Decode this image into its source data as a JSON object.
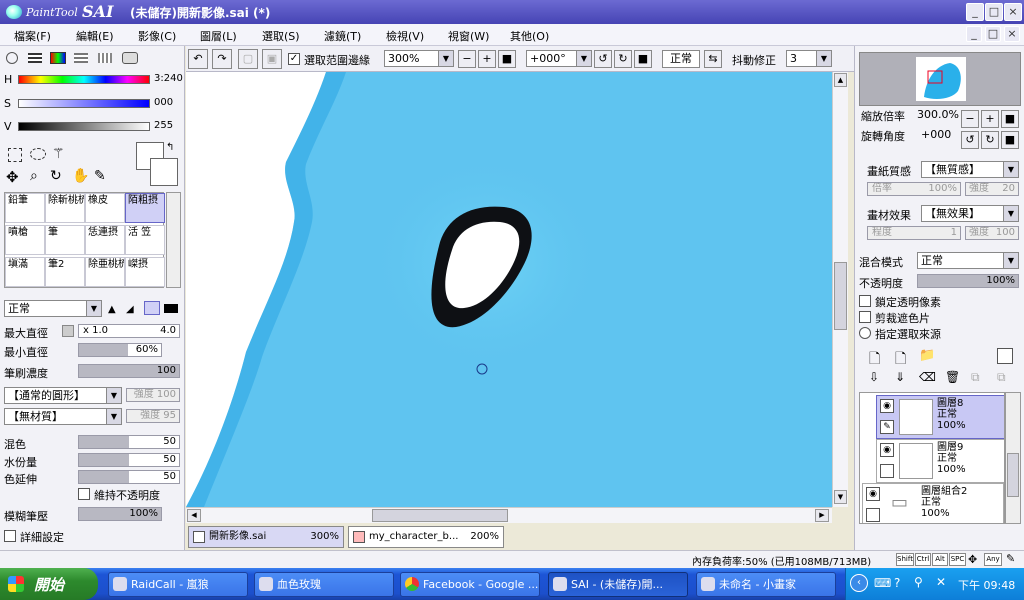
{
  "app": {
    "logo_small": "PaintTool",
    "logo_big": "SAI",
    "title": "(未儲存)開新影像.sai (*)"
  },
  "window_buttons": [
    "_",
    "□",
    "×"
  ],
  "menu": [
    "檔案(F)",
    "編輯(E)",
    "影像(C)",
    "圖層(L)",
    "選取(S)",
    "濾鏡(T)",
    "檢視(V)",
    "視窗(W)",
    "其他(O)"
  ],
  "color": {
    "h_label": "H",
    "h_value": "3:240",
    "s_label": "S",
    "s_value": "000",
    "v_label": "V",
    "v_value": "255"
  },
  "tools": [
    {
      "name": "鉛筆"
    },
    {
      "name": "除斬桃梳凋"
    },
    {
      "name": "橡皮"
    },
    {
      "name": "陌粗摂"
    },
    {
      "name": "噴槍"
    },
    {
      "name": "筆"
    },
    {
      "name": "恁連摂"
    },
    {
      "name": "活 笠"
    },
    {
      "name": "塡滿"
    },
    {
      "name": "筆2"
    },
    {
      "name": "除亜桃梳凋"
    },
    {
      "name": "嵥摂"
    }
  ],
  "brush": {
    "mode": "正常",
    "max_size_label": "最大直徑",
    "max_size_mult": "x 1.0",
    "max_size_value": "4.0",
    "min_size_label": "最小直徑",
    "min_size_value": "60%",
    "min_size_fill": 0.6,
    "density_label": "筆刷濃度",
    "density_value": "100",
    "density_fill": 1.0,
    "shape": "【通常的圓形】",
    "shape_strength": "強度 100",
    "texture": "【無材質】",
    "texture_strength": "強度 95",
    "blend_label": "混色",
    "blend_value": "50",
    "blend_fill": 0.5,
    "water_label": "水份量",
    "water_value": "50",
    "water_fill": 0.5,
    "stretch_label": "色延伸",
    "stretch_value": "50",
    "stretch_fill": 0.5,
    "keep_opacity": "維持不透明度",
    "blur_label": "模糊筆壓",
    "blur_value": "100%",
    "blur_fill": 1.0,
    "detail": "詳細設定"
  },
  "toolbar": {
    "select_edge": "選取范圍邊緣",
    "zoom": "300%",
    "angle": "+000°",
    "blend": "正常",
    "stabilizer_label": "抖動修正",
    "stabilizer": "3"
  },
  "tabs": [
    {
      "name": "開新影像.sai",
      "zoom": "300%"
    },
    {
      "name": "my_character_b...",
      "zoom": "200%"
    }
  ],
  "navigator": {
    "zoom_label": "縮放倍率",
    "zoom_value": "300.0%",
    "rot_label": "旋轉角度",
    "rot_value": "+000"
  },
  "layer_props": {
    "paper_label": "畫紙質感",
    "paper_value": "【無質感】",
    "paper_scale": "倍率",
    "paper_scale_value": "100%",
    "paper_strength": "強度",
    "paper_strength_value": "20",
    "effect_label": "畫材效果",
    "effect_value": "【無效果】",
    "effect_degree": "程度",
    "effect_degree_value": "1",
    "effect_strength": "強度",
    "effect_strength_value": "100",
    "blend_label": "混合模式",
    "blend_value": "正常",
    "opacity_label": "不透明度",
    "opacity_value": "100%",
    "lock": "鎖定透明像素",
    "clip": "剪裁遮色片",
    "source": "指定選取來源"
  },
  "layers": [
    {
      "name": "圖層8",
      "mode": "正常",
      "opacity": "100%",
      "selected": true
    },
    {
      "name": "圖層9",
      "mode": "正常",
      "opacity": "100%",
      "selected": false
    },
    {
      "name": "圖層組合2",
      "mode": "正常",
      "opacity": "100%",
      "selected": false
    }
  ],
  "status": {
    "memory": "內存負荷率:50% (已用108MB/713MB)",
    "keys": [
      "Shift",
      "Ctrl",
      "Alt",
      "SPC",
      "Any"
    ]
  },
  "taskbar": {
    "start": "開始",
    "items": [
      "RaidCall - 嵐狼",
      "血色玫瑰",
      "Facebook - Google ...",
      "SAI - (未儲存)開...",
      "未命名 - 小畫家"
    ],
    "clock": "下午 09:48"
  },
  "colors": {
    "title": "#5553c2",
    "canvas": "#5fc4f0",
    "selected_layer": "#c8c8f4"
  }
}
